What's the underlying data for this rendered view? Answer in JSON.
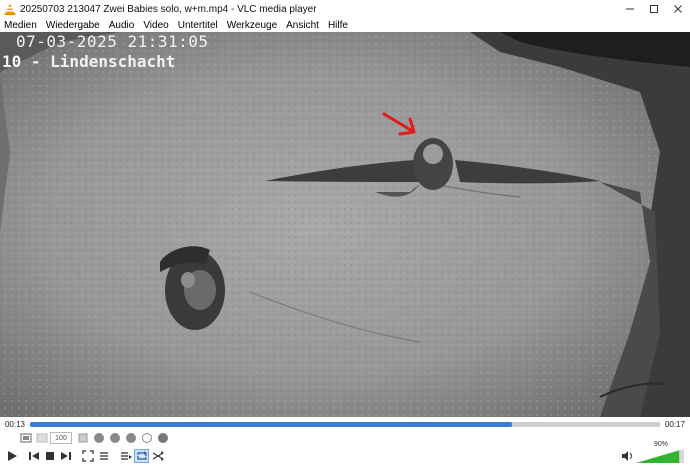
{
  "window": {
    "title": "20250703 213047 Zwei Babies solo, w+m.mp4 - VLC media player",
    "controls": [
      "minimize-icon",
      "maximize-icon",
      "close-icon"
    ]
  },
  "menu": {
    "items": [
      "Medien",
      "Wiedergabe",
      "Audio",
      "Video",
      "Untertitel",
      "Werkzeuge",
      "Ansicht",
      "Hilfe"
    ]
  },
  "video": {
    "osd_datetime": "07-03-2025 21:31:05",
    "osd_camera": "10 - Lindenschacht",
    "annotation_color": "#e01b1b"
  },
  "playback": {
    "elapsed": "00:13",
    "total": "00:17",
    "progress": 0.765,
    "accent_color": "#3a7bd5"
  },
  "toolbar1": {
    "speed_value": "100"
  },
  "volume": {
    "percent_label": "90%",
    "level": 0.9
  }
}
